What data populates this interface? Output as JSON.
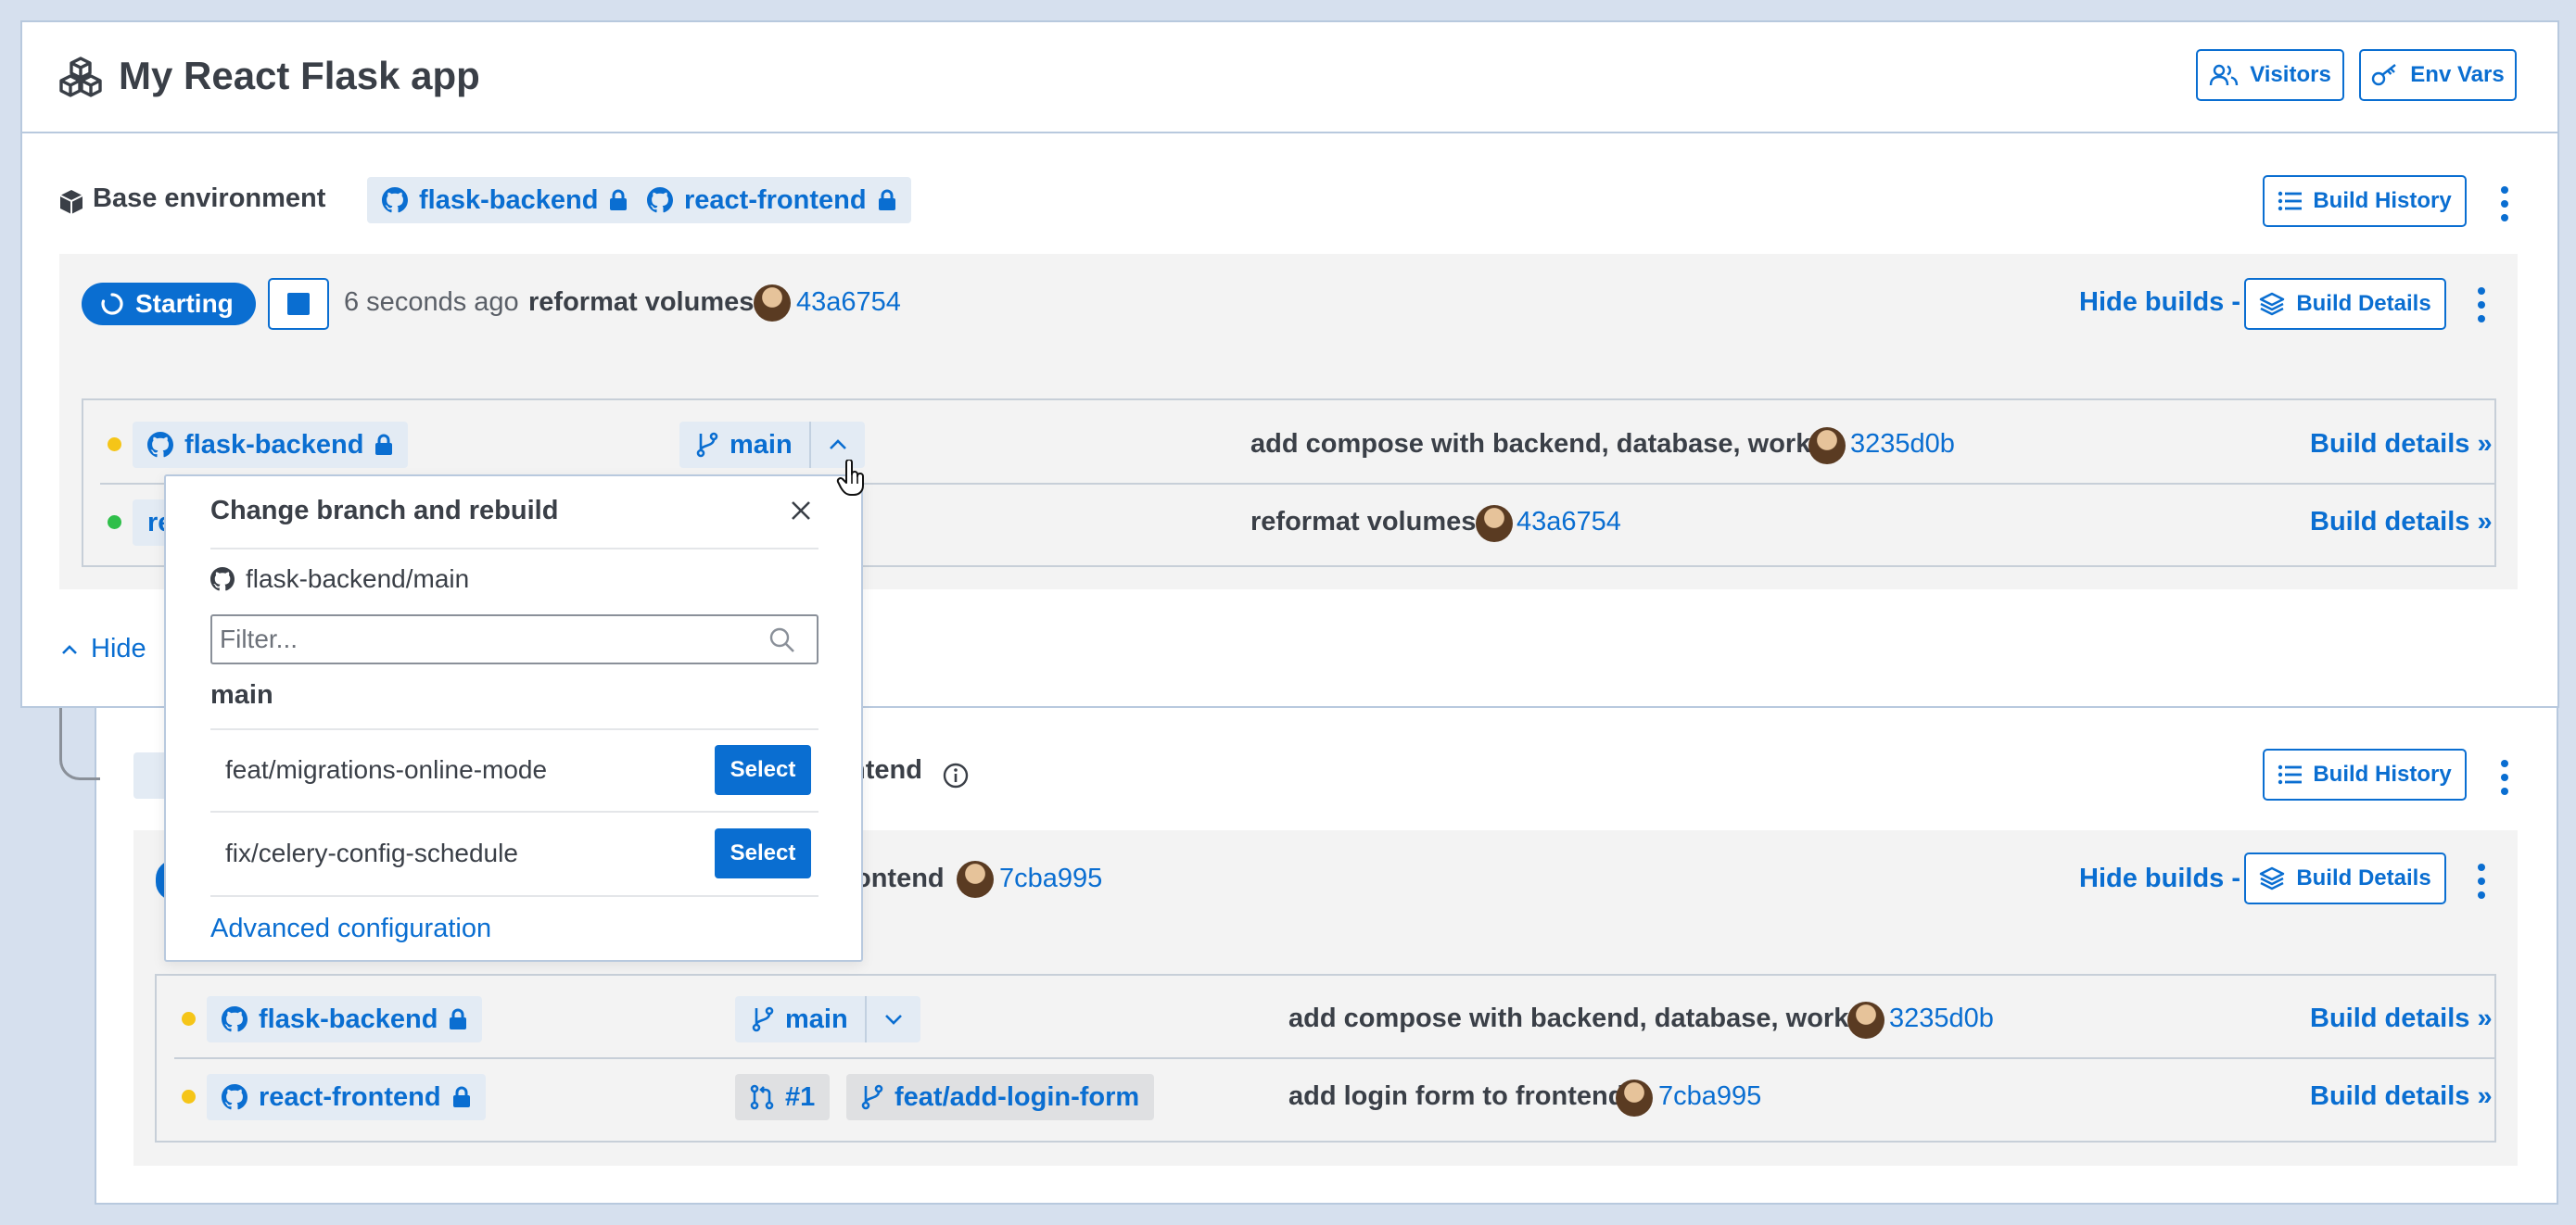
{
  "app": {
    "title": "My React Flask app",
    "visitors_label": "Visitors",
    "envvars_label": "Env Vars"
  },
  "base_env": {
    "label": "Base environment",
    "repos": [
      "flask-backend",
      "react-frontend"
    ],
    "build_history_label": "Build History",
    "status_label": "Starting",
    "time_ago": "6 seconds ago",
    "commit_message": "reformat volumes",
    "commit_sha": "43a6754",
    "hide_builds_label": "Hide builds -",
    "build_details_label": "Build Details",
    "rows": [
      {
        "repo": "flask-backend",
        "branch": "main",
        "commit": "add compose with backend, database, worker",
        "sha": "3235d0b",
        "link": "Build details »",
        "status": "yellow"
      },
      {
        "repo": "react-frontend",
        "commit": "reformat volumes",
        "sha": "43a6754",
        "link": "Build details »",
        "status": "green"
      }
    ],
    "hide_label": "Hide"
  },
  "second_env": {
    "label_suffix": "ntend",
    "build_history_label": "Build History",
    "commit_message_suffix": "ontend",
    "commit_sha": "7cba995",
    "hide_builds_label": "Hide builds -",
    "build_details_label": "Build Details",
    "rows": [
      {
        "repo": "flask-backend",
        "branch": "main",
        "commit": "add compose with backend, database, worker",
        "sha": "3235d0b",
        "link": "Build details »",
        "status": "yellow"
      },
      {
        "repo": "react-frontend",
        "pr": "#1",
        "branch": "feat/add-login-form",
        "commit": "add login form to frontend",
        "sha": "7cba995",
        "link": "Build details »",
        "status": "yellow"
      }
    ]
  },
  "popup": {
    "title": "Change branch and rebuild",
    "repo_path": "flask-backend/main",
    "filter_placeholder": "Filter...",
    "current_branch": "main",
    "branches": [
      {
        "name": "feat/migrations-online-mode",
        "action": "Select"
      },
      {
        "name": "fix/celery-config-schedule",
        "action": "Select"
      }
    ],
    "advanced_label": "Advanced configuration"
  },
  "colors": {
    "accent": "#0a6ed1",
    "background": "#d6e0ee",
    "panel": "#f3f3f3",
    "status_yellow": "#f5c518",
    "status_green": "#2fbf4a"
  }
}
